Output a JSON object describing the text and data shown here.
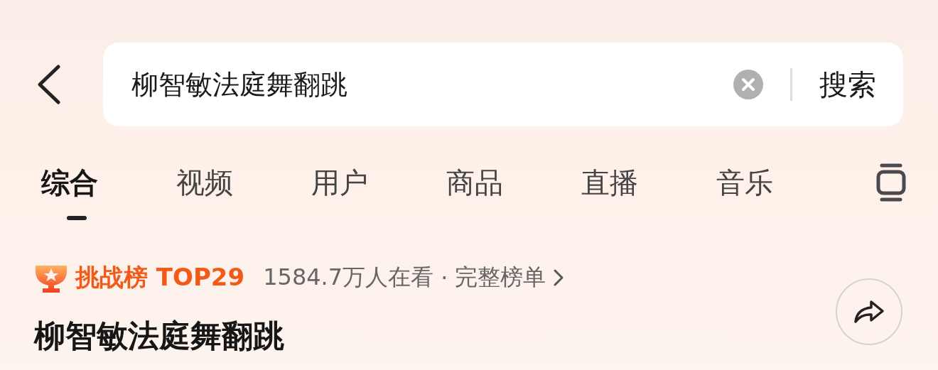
{
  "search": {
    "value": "柳智敏法庭舞翻跳",
    "button": "搜索"
  },
  "tabs": [
    {
      "label": "综合",
      "selected": true
    },
    {
      "label": "视频",
      "selected": false
    },
    {
      "label": "用户",
      "selected": false
    },
    {
      "label": "商品",
      "selected": false
    },
    {
      "label": "直播",
      "selected": false
    },
    {
      "label": "音乐",
      "selected": false
    }
  ],
  "ranking": {
    "badge": "挑战榜 TOP29",
    "viewers": "1584.7万人在看",
    "separator": "·",
    "link": "完整榜单"
  },
  "title": "柳智敏法庭舞翻跳"
}
